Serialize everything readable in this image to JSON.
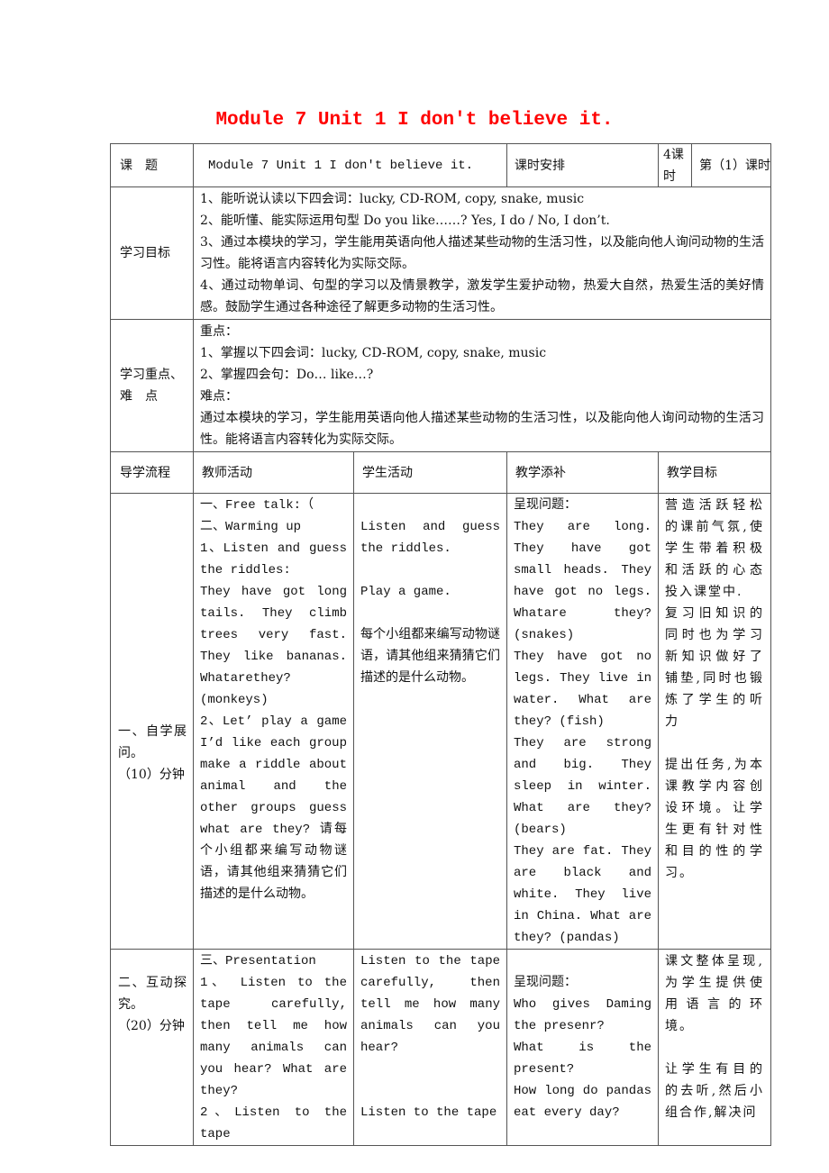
{
  "title": "Module 7  Unit 1 I don't believe it.",
  "header_row": {
    "topic_label": "课　题",
    "topic_value": "Module 7  Unit 1 I don't believe it.",
    "schedule_label": "课时安排",
    "periods": "4课时",
    "current_period": "第（1）课时"
  },
  "objectives": {
    "label": "学习目标",
    "items": [
      "1、能听说认读以下四会词：lucky, CD-ROM, copy, snake, music",
      "2、能听懂、能实际运用句型 Do you like……? Yes, I do / No, I don’t.",
      "3、通过本模块的学习，学生能用英语向他人描述某些动物的生活习性，以及能向他人询问动物的生活习性。能将语言内容转化为实际交际。",
      "4、通过动物单词、句型的学习以及情景教学，激发学生爱护动物，热爱大自然，热爱生活的美好情感。鼓励学生通过各种途径了解更多动物的生活习性。"
    ]
  },
  "key_points": {
    "label": "学习重点、难　点",
    "focus_heading": "重点：",
    "focus_items": [
      "1、掌握以下四会词：lucky, CD-ROM, copy, snake, music",
      "2、掌握四会句：Do… like…?"
    ],
    "difficulty_heading": "难点：",
    "difficulty_text": "通过本模块的学习，学生能用英语向他人描述某些动物的生活习性，以及能向他人询问动物的生活习性。能将语言内容转化为实际交际。"
  },
  "process_headers": [
    "导学流程",
    "教师活动",
    "学生活动",
    "教学添补",
    "教学目标"
  ],
  "stages": [
    {
      "stage": [
        "一、自学展问。",
        "（10）分钟"
      ],
      "teacher": [
        "一、Free talk:（",
        "二、Warming up",
        "1、Listen and guess the riddles:",
        "They have got long tails. They climb trees very fast. They like bananas. Whatarethey?(monkeys)",
        "2、Let’ play a game I’d like each group make a riddle about animal and the other groups guess what are they? 请每个小组都来编写动物谜语，请其他组来猜猜它们描述的是什么动物。"
      ],
      "student": [
        "",
        "Listen and guess the riddles.",
        "",
        "Play a game.",
        "",
        "每个小组都来编写动物谜语，请其他组来猜猜它们描述的是什么动物。"
      ],
      "supplement": [
        "呈现问题：",
        "They are long. They have got small heads. They have got no legs. Whatare they? (snakes)",
        "They have got no legs. They live in water. What are they? (fish)",
        "They are strong and big. They sleep in winter. What are they? (bears)",
        "They are fat. They are black and white. They live in China. What are they? (pandas)"
      ],
      "goal": [
        "营造活跃轻松的课前气氛,使学生带着积极和活跃的心态投入课堂中.",
        "复习旧知识的同时也为学习新知识做好了铺垫,同时也锻炼了学生的听力",
        "",
        "提出任务,为本课教学内容创设环境。让学生更有针对性和目的性的学习。"
      ]
    },
    {
      "stage": [
        "二、互动探究。",
        "（20）分钟"
      ],
      "teacher": [
        "三、Presentation",
        "1、 Listen to the tape carefully, then tell me how many animals can you hear? What are they?",
        "2、Listen to the tape"
      ],
      "student": [
        "Listen to the tape carefully, then tell me how many animals can you hear?",
        "",
        "",
        "Listen to the tape"
      ],
      "supplement": [
        "",
        "呈现问题：",
        "Who gives Daming the presenr?",
        "What is the present?",
        "How long do pandas eat every day?"
      ],
      "goal": [
        "课文整体呈现,为学生提供使用语言的环境。",
        "",
        "让学生有目的的去听,然后小组合作,解决问"
      ]
    }
  ]
}
